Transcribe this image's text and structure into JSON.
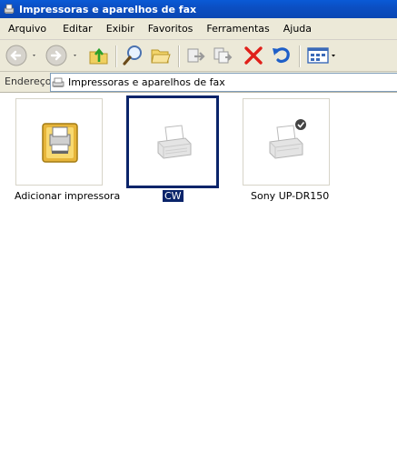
{
  "window": {
    "title": "Impressoras e aparelhos de fax"
  },
  "menu": {
    "items": [
      "Arquivo",
      "Editar",
      "Exibir",
      "Favoritos",
      "Ferramentas",
      "Ajuda"
    ]
  },
  "toolbar": {
    "icons": [
      "back-icon",
      "forward-icon",
      "folder-up-icon",
      "search-icon",
      "folders-icon",
      "move-to-icon",
      "copy-to-icon",
      "delete-icon",
      "undo-icon",
      "views-icon"
    ]
  },
  "address": {
    "label": "Endereço",
    "value": "Impressoras e aparelhos de fax"
  },
  "items": [
    {
      "label": "Adicionar impressora",
      "icon": "add-printer-icon",
      "selected": false
    },
    {
      "label": "CW",
      "icon": "printer-icon",
      "selected": true
    },
    {
      "label": "Sony UP-DR150",
      "icon": "default-printer-icon",
      "selected": false
    }
  ]
}
